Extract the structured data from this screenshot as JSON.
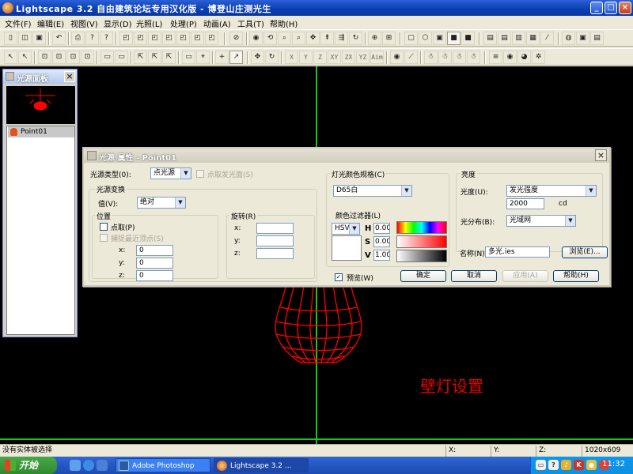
{
  "window": {
    "title": "Lightscape 3.2 自由建筑论坛专用汉化版  - 博登山庄测光生",
    "minimize": "_",
    "maximize": "□",
    "close": "×"
  },
  "menu": [
    "文件(F)",
    "编辑(E)",
    "视图(V)",
    "显示(D)",
    "光照(L)",
    "处理(P)",
    "动画(A)",
    "工具(T)",
    "帮助(H)"
  ],
  "toolbar2_axes": [
    "X",
    "Y",
    "Z",
    "XY",
    "ZX",
    "YZ",
    "Aim"
  ],
  "light_panel": {
    "title": "光源面板",
    "items": [
      "Point01"
    ]
  },
  "viewport": {
    "caption": "壁灯设置",
    "colors": {
      "background": "#000000",
      "axis": "#19c81e",
      "wireframe": "#ff0000"
    }
  },
  "dialog": {
    "title": "光源 属性 - Point01",
    "light_type_label": "光源类型(0):",
    "light_type_value": "点光源",
    "emit_surface_label": "点取发光面(S)",
    "transform_group": "光源变换",
    "value_label": "值(V):",
    "value_value": "绝对",
    "position_group": "位置",
    "pick_label": "点取(P)",
    "snap_label": "捕捉最近顶点(S)",
    "x_label": "x:",
    "y_label": "y:",
    "z_label": "z:",
    "pos_x": "0",
    "pos_y": "0",
    "pos_z": "0",
    "rotation_group": "旋转(R)",
    "rot_x": "",
    "rot_y": "",
    "rot_z": "",
    "color_spec_group": "灯光颜色规格(C)",
    "color_spec_value": "D65白",
    "filter_label": "颜色过滤器(L)",
    "color_model": "HSV",
    "h_label": "H",
    "s_label": "S",
    "v_label": "V",
    "h_value": "0.00",
    "s_value": "0.00",
    "v_value": "1.00",
    "brightness_group": "亮度",
    "intensity_label": "光度(U):",
    "intensity_mode": "发光强度",
    "intensity_value": "2000",
    "intensity_unit": "cd",
    "distribution_label": "光分布(B):",
    "distribution_value": "光域网",
    "name_label": "名称(N)",
    "file_name": "多光.ies",
    "browse_button": "浏览(E)...",
    "preview_label": "预览(W)",
    "preview_checked": "✓",
    "ok_button": "确定",
    "cancel_button": "取消",
    "apply_button": "应用(A)",
    "help_button": "帮助(H)"
  },
  "status": {
    "message": "没有实体被选择",
    "x_label": "X:",
    "y_label": "Y:",
    "z_label": "Z:",
    "resolution": "1020x609"
  },
  "taskbar": {
    "start": "开始",
    "tasks": [
      "Adobe Photoshop",
      "Lightscape 3.2 ..."
    ],
    "clock": "11:32"
  }
}
